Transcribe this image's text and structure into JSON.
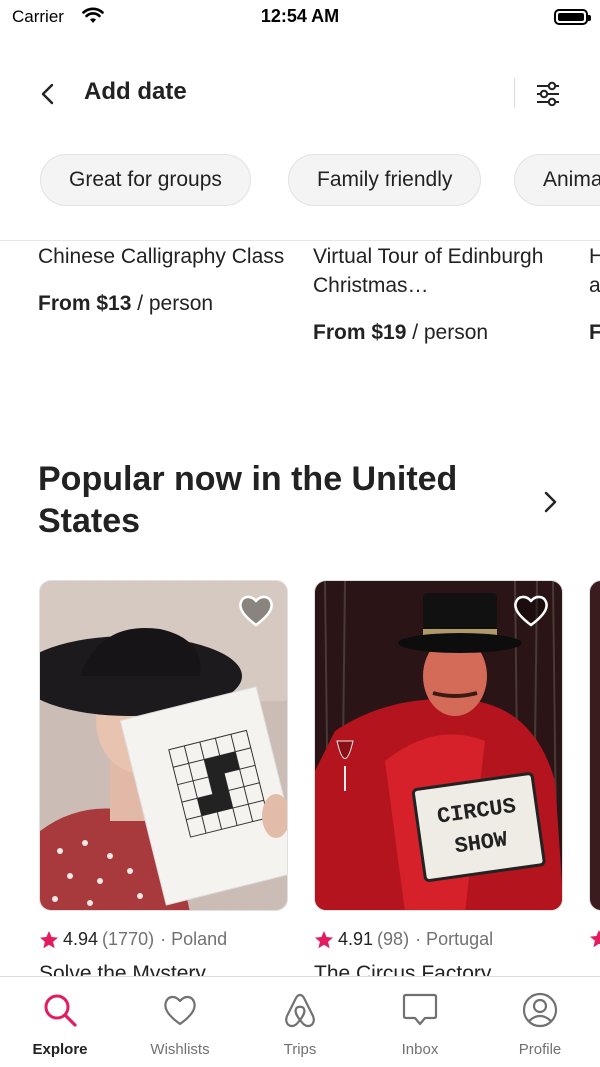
{
  "status_bar": {
    "carrier": "Carrier",
    "time": "12:54 AM"
  },
  "header": {
    "title": "Add date"
  },
  "chips": [
    {
      "label": "Great for groups"
    },
    {
      "label": "Family friendly"
    },
    {
      "label": "Animals"
    }
  ],
  "top_cards": [
    {
      "title": "Chinese Calligraphy Class",
      "price_bold": "From $13",
      "price_unit": " / person"
    },
    {
      "title": "Virtual Tour of Edinburgh Christmas…",
      "price_bold": "From $19",
      "price_unit": " / person"
    },
    {
      "title": "H a",
      "price_bold": "F",
      "price_unit": ""
    }
  ],
  "section": {
    "title": "Popular now in the United States"
  },
  "popular_cards": [
    {
      "rating": "4.94",
      "count": "(1770)",
      "country": "· Poland",
      "title": "Solve the Mystery"
    },
    {
      "rating": "4.91",
      "count": "(98)",
      "country": "· Portugal",
      "title": "The Circus Factory"
    }
  ],
  "popular_image_text": {
    "sign_line1": "CIRCUS",
    "sign_line2": "SHOW"
  },
  "tabbar": [
    {
      "label": "Explore",
      "icon": "search-icon"
    },
    {
      "label": "Wishlists",
      "icon": "heart-icon"
    },
    {
      "label": "Trips",
      "icon": "airbnb-logo-icon"
    },
    {
      "label": "Inbox",
      "icon": "message-icon"
    },
    {
      "label": "Profile",
      "icon": "profile-icon"
    }
  ],
  "colors": {
    "accent": "#E31C5F",
    "star": "#E31C5F",
    "text": "#222222",
    "muted": "#717171"
  }
}
